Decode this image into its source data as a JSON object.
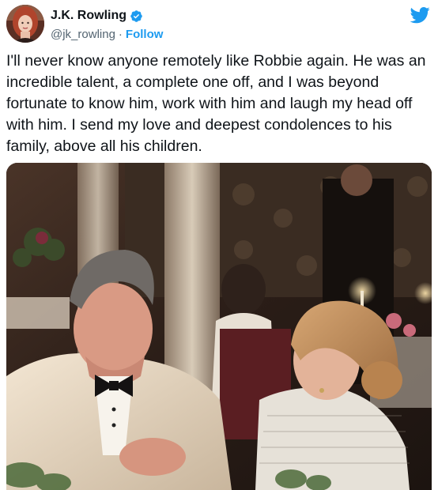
{
  "author": {
    "display_name": "J.K. Rowling",
    "handle": "@jk_rowling",
    "separator": "·",
    "follow_label": "Follow",
    "verified_color": "#1d9bf0",
    "avatar_icon": "avatar-photo"
  },
  "brand": {
    "icon": "twitter-bird-icon",
    "color": "#1d9bf0"
  },
  "tweet": {
    "text": "I'll never know anyone remotely like Robbie again. He was an incredible talent, a complete one off, and I was beyond fortunate to know him, work with him and laugh my head off with him. I send my love and deepest condolences to his family, above all his children."
  },
  "media": {
    "kind": "photo"
  }
}
